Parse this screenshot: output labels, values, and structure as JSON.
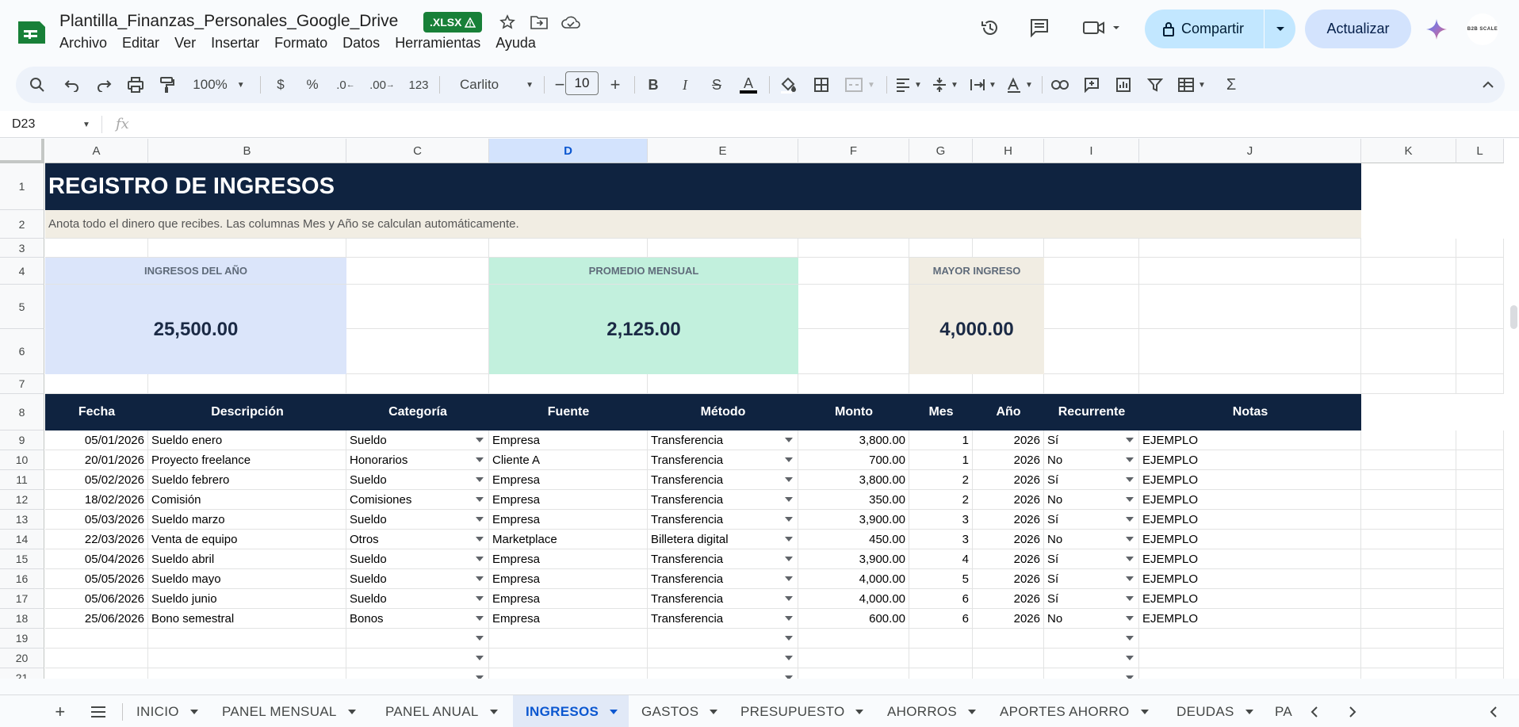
{
  "app": {
    "doc_title": "Plantilla_Finanzas_Personales_Google_Drive",
    "file_badge": ".XLSX",
    "share_label": "Compartir",
    "update_label": "Actualizar",
    "avatar_text": "B2B SCALE",
    "menu": [
      "Archivo",
      "Editar",
      "Ver",
      "Insertar",
      "Formato",
      "Datos",
      "Herramientas",
      "Ayuda"
    ]
  },
  "toolbar": {
    "zoom": "100%",
    "currency": "$",
    "percent": "%",
    "dec_minus": ".0",
    "dec_plus": ".00",
    "format_123": "123",
    "font": "Carlito",
    "font_size": "10",
    "bold": "B",
    "italic": "I",
    "strike": "S",
    "text_color": "A"
  },
  "formula_bar": {
    "cell_ref": "D23",
    "fx": "fx",
    "formula": ""
  },
  "columns": [
    "A",
    "B",
    "C",
    "D",
    "E",
    "F",
    "G",
    "H",
    "I",
    "J",
    "K",
    "L"
  ],
  "rows": [
    "1",
    "2",
    "3",
    "4",
    "5",
    "6",
    "7",
    "8",
    "9",
    "10",
    "11",
    "12",
    "13",
    "14",
    "15",
    "16",
    "17",
    "18",
    "19",
    "20",
    "21"
  ],
  "sheet": {
    "title": "REGISTRO DE INGRESOS",
    "subtitle": "Anota todo el dinero que recibes. Las columnas Mes y Año se calculan automáticamente.",
    "kpis": [
      {
        "label": "INGRESOS DEL AÑO",
        "value": "25,500.00",
        "color": "#dbe5fa"
      },
      {
        "label": "PROMEDIO MENSUAL",
        "value": "2,125.00",
        "color": "#c2f0dd"
      },
      {
        "label": "MAYOR INGRESO",
        "value": "4,000.00",
        "color": "#f1ede3"
      }
    ],
    "headers": [
      "Fecha",
      "Descripción",
      "Categoría",
      "Fuente",
      "Método",
      "Monto",
      "Mes",
      "Año",
      "Recurrente",
      "Notas"
    ],
    "records": [
      [
        "05/01/2026",
        "Sueldo enero",
        "Sueldo",
        "Empresa",
        "Transferencia",
        "3,800.00",
        "1",
        "2026",
        "Sí",
        "EJEMPLO"
      ],
      [
        "20/01/2026",
        "Proyecto freelance",
        "Honorarios",
        "Cliente A",
        "Transferencia",
        "700.00",
        "1",
        "2026",
        "No",
        "EJEMPLO"
      ],
      [
        "05/02/2026",
        "Sueldo febrero",
        "Sueldo",
        "Empresa",
        "Transferencia",
        "3,800.00",
        "2",
        "2026",
        "Sí",
        "EJEMPLO"
      ],
      [
        "18/02/2026",
        "Comisión",
        "Comisiones",
        "Empresa",
        "Transferencia",
        "350.00",
        "2",
        "2026",
        "No",
        "EJEMPLO"
      ],
      [
        "05/03/2026",
        "Sueldo marzo",
        "Sueldo",
        "Empresa",
        "Transferencia",
        "3,900.00",
        "3",
        "2026",
        "Sí",
        "EJEMPLO"
      ],
      [
        "22/03/2026",
        "Venta de equipo",
        "Otros",
        "Marketplace",
        "Billetera digital",
        "450.00",
        "3",
        "2026",
        "No",
        "EJEMPLO"
      ],
      [
        "05/04/2026",
        "Sueldo abril",
        "Sueldo",
        "Empresa",
        "Transferencia",
        "3,900.00",
        "4",
        "2026",
        "Sí",
        "EJEMPLO"
      ],
      [
        "05/05/2026",
        "Sueldo mayo",
        "Sueldo",
        "Empresa",
        "Transferencia",
        "4,000.00",
        "5",
        "2026",
        "Sí",
        "EJEMPLO"
      ],
      [
        "05/06/2026",
        "Sueldo junio",
        "Sueldo",
        "Empresa",
        "Transferencia",
        "4,000.00",
        "6",
        "2026",
        "Sí",
        "EJEMPLO"
      ],
      [
        "25/06/2026",
        "Bono semestral",
        "Bonos",
        "Empresa",
        "Transferencia",
        "600.00",
        "6",
        "2026",
        "No",
        "EJEMPLO"
      ]
    ]
  },
  "tabs": [
    {
      "label": "INICIO",
      "active": false
    },
    {
      "label": "PANEL MENSUAL",
      "active": false
    },
    {
      "label": "PANEL ANUAL",
      "active": false
    },
    {
      "label": "INGRESOS",
      "active": true
    },
    {
      "label": "GASTOS",
      "active": false
    },
    {
      "label": "PRESUPUESTO",
      "active": false
    },
    {
      "label": "AHORROS",
      "active": false
    },
    {
      "label": "APORTES AHORRO",
      "active": false
    },
    {
      "label": "DEUDAS",
      "active": false
    },
    {
      "label": "PA",
      "active": false
    }
  ],
  "colors": {
    "banner": "#0f2340",
    "accent": "#0b57d0",
    "share": "#c2e7ff",
    "xlsx": "#188038"
  }
}
